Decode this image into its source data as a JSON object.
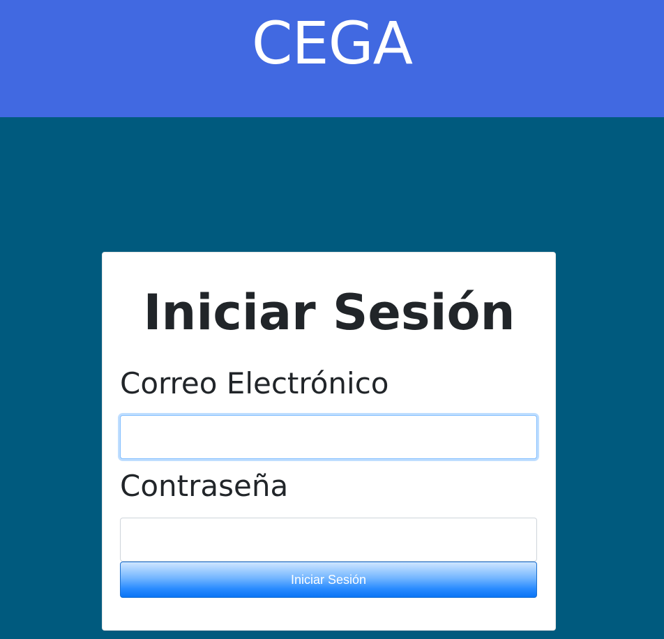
{
  "header": {
    "brand": "CEGA",
    "background_color": "#4169e1"
  },
  "page": {
    "background_color": "#005a7e"
  },
  "login_form": {
    "title": "Iniciar Sesión",
    "email_label": "Correo Electrónico",
    "email_value": "",
    "password_label": "Contraseña",
    "password_value": "",
    "submit_label": "Iniciar Sesión",
    "submit_color": "#0a74f5"
  }
}
